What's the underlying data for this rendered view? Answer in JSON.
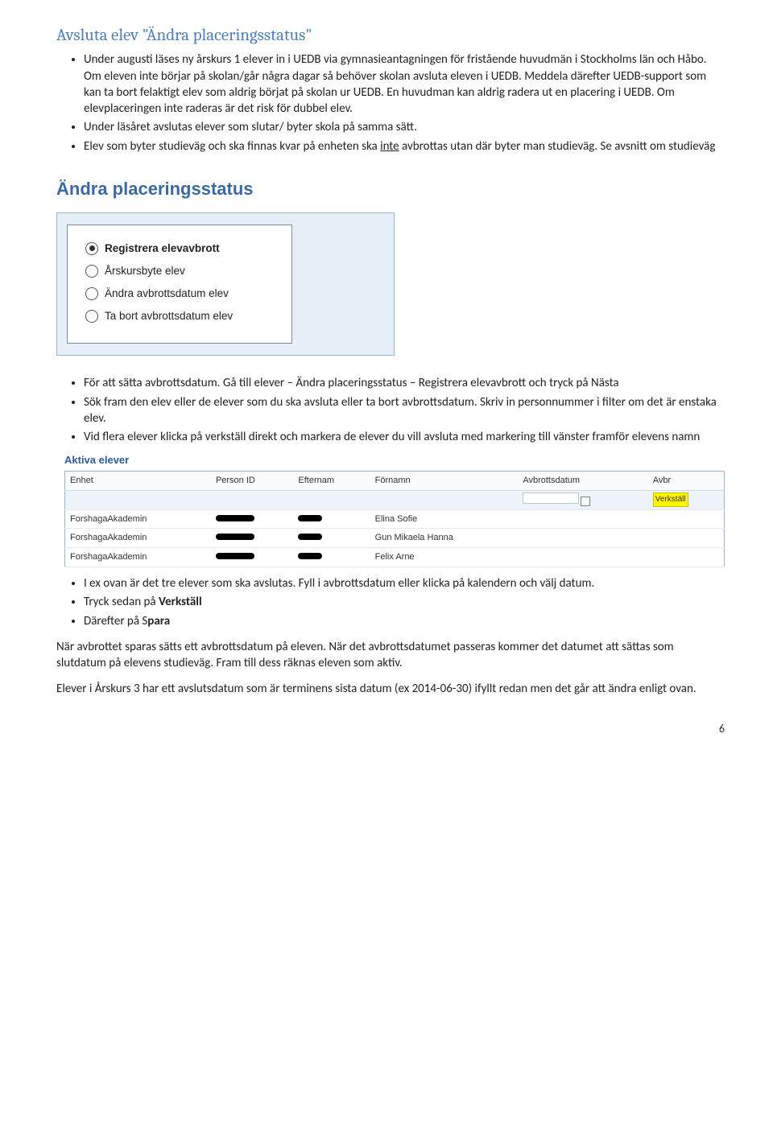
{
  "title": "Avsluta elev \"Ändra placeringsstatus\"",
  "bullets1": [
    "Under augusti läses ny årskurs 1 elever in i UEDB via gymnasieantagningen för fristående huvudmän i Stockholms län och Håbo. Om eleven inte börjar på skolan/går några dagar så behöver skolan avsluta eleven i UEDB. Meddela därefter UEDB-support som kan ta bort felaktigt elev som aldrig börjat på skolan ur UEDB. En huvudman kan aldrig radera ut en placering i UEDB. Om elevplaceringen inte raderas är det risk för dubbel elev.",
    "Under läsåret avslutas elever som slutar/ byter skola på samma sätt.",
    "Elev som byter studieväg och ska finnas kvar på enheten ska <span class=\"under\">inte</span> avbrottas utan där byter man studieväg. Se avsnitt om studieväg"
  ],
  "img1": {
    "heading": "Ändra placeringsstatus",
    "options": [
      {
        "label": "Registrera elevavbrott",
        "selected": true
      },
      {
        "label": "Årskursbyte elev",
        "selected": false
      },
      {
        "label": "Ändra avbrottsdatum elev",
        "selected": false
      },
      {
        "label": "Ta bort avbrottsdatum elev",
        "selected": false
      }
    ]
  },
  "bullets2": [
    "För att sätta avbrottsdatum. Gå till elever – Ändra placeringsstatus – Registrera elevavbrott och tryck på Nästa",
    "Sök fram den elev eller de elever som du ska avsluta eller ta bort avbrottsdatum. Skriv in personnummer i filter om det är enstaka elev.",
    "Vid flera elever klicka på verkställ direkt och markera de elever du vill avsluta med markering till vänster framför elevens namn"
  ],
  "img2": {
    "heading": "Aktiva elever",
    "columns": [
      "Enhet",
      "Person ID",
      "Efternam",
      "Förnamn",
      "Avbrottsdatum",
      "Avbr"
    ],
    "verkstall": "Verkställ",
    "rows": [
      {
        "enhet": "ForshagaAkademin",
        "fornamn": "Elina Sofie"
      },
      {
        "enhet": "ForshagaAkademin",
        "fornamn": "Gun Mikaela Hanna"
      },
      {
        "enhet": "ForshagaAkademin",
        "fornamn": "Felix Arne"
      }
    ]
  },
  "bullets3": [
    "I ex ovan är det tre elever som ska avslutas. Fyll i avbrottsdatum eller klicka på kalendern och välj datum.",
    "Tryck sedan på <span class=\"bold\">Verkställ</span>",
    "Därefter på S<span class=\"bold\">para</span>"
  ],
  "para1": "När avbrottet sparas sätts ett avbrottsdatum på eleven. När det avbrottsdatumet passeras kommer det datumet att sättas som slutdatum på elevens studieväg. Fram till dess räknas eleven som aktiv.",
  "para2": "Elever i Årskurs 3 har ett avslutsdatum som är terminens sista datum (ex 2014-06-30) ifyllt redan men det går att ändra enligt ovan.",
  "pagenum": "6"
}
